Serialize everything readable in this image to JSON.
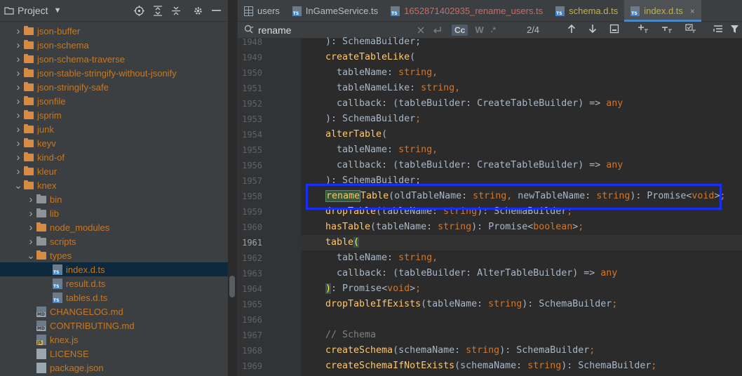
{
  "project": {
    "title": "Project",
    "tree": [
      {
        "label": "json-buffer",
        "kind": "folder",
        "depth": 1,
        "color": "orange",
        "expanded": false
      },
      {
        "label": "json-schema",
        "kind": "folder",
        "depth": 1,
        "color": "orange",
        "expanded": false
      },
      {
        "label": "json-schema-traverse",
        "kind": "folder",
        "depth": 1,
        "color": "orange",
        "expanded": false
      },
      {
        "label": "json-stable-stringify-without-jsonify",
        "kind": "folder",
        "depth": 1,
        "color": "orange",
        "expanded": false
      },
      {
        "label": "json-stringify-safe",
        "kind": "folder",
        "depth": 1,
        "color": "orange",
        "expanded": false
      },
      {
        "label": "jsonfile",
        "kind": "folder",
        "depth": 1,
        "color": "orange",
        "expanded": false
      },
      {
        "label": "jsprim",
        "kind": "folder",
        "depth": 1,
        "color": "orange",
        "expanded": false
      },
      {
        "label": "junk",
        "kind": "folder",
        "depth": 1,
        "color": "orange",
        "expanded": false
      },
      {
        "label": "keyv",
        "kind": "folder",
        "depth": 1,
        "color": "orange",
        "expanded": false
      },
      {
        "label": "kind-of",
        "kind": "folder",
        "depth": 1,
        "color": "orange",
        "expanded": false
      },
      {
        "label": "kleur",
        "kind": "folder",
        "depth": 1,
        "color": "orange",
        "expanded": false
      },
      {
        "label": "knex",
        "kind": "folder",
        "depth": 1,
        "color": "orange",
        "expanded": true
      },
      {
        "label": "bin",
        "kind": "folder",
        "depth": 2,
        "color": "orange",
        "expanded": false
      },
      {
        "label": "lib",
        "kind": "folder",
        "depth": 2,
        "color": "orange",
        "expanded": false
      },
      {
        "label": "node_modules",
        "kind": "folder",
        "depth": 2,
        "color": "orange",
        "expanded": false
      },
      {
        "label": "scripts",
        "kind": "folder",
        "depth": 2,
        "color": "orange",
        "expanded": false
      },
      {
        "label": "types",
        "kind": "folder",
        "depth": 2,
        "color": "orange",
        "expanded": true
      },
      {
        "label": "index.d.ts",
        "kind": "file-ts",
        "depth": 3,
        "color": "orange",
        "selected": true
      },
      {
        "label": "result.d.ts",
        "kind": "file-ts",
        "depth": 3,
        "color": "orange"
      },
      {
        "label": "tables.d.ts",
        "kind": "file-ts",
        "depth": 3,
        "color": "orange"
      },
      {
        "label": "CHANGELOG.md",
        "kind": "file-md",
        "depth": 2,
        "color": "orange"
      },
      {
        "label": "CONTRIBUTING.md",
        "kind": "file-md",
        "depth": 2,
        "color": "orange"
      },
      {
        "label": "knex.js",
        "kind": "file-js",
        "depth": 2,
        "color": "orange"
      },
      {
        "label": "LICENSE",
        "kind": "file-txt",
        "depth": 2,
        "color": "orange"
      },
      {
        "label": "package.json",
        "kind": "file-json",
        "depth": 2,
        "color": "orange"
      }
    ]
  },
  "tabs": [
    {
      "label": "users",
      "icon": "table-icon",
      "color": "normal"
    },
    {
      "label": "InGameService.ts",
      "icon": "ts-file-icon",
      "color": "normal"
    },
    {
      "label": "1652871402935_rename_users.ts",
      "icon": "ts-file-icon",
      "color": "red"
    },
    {
      "label": "schema.d.ts",
      "icon": "ts-file-icon",
      "color": "yellow"
    },
    {
      "label": "index.d.ts",
      "icon": "ts-file-icon",
      "color": "yellow",
      "active": true
    }
  ],
  "search": {
    "query": "rename",
    "match_case_label": "Cc",
    "words_label": "W",
    "regex_label": ".*",
    "match_count": "2/4"
  },
  "editor": {
    "lines": [
      {
        "n": "1948",
        "tokens": [
          [
            "typ",
            "): SchemaBuilder;"
          ]
        ]
      },
      {
        "n": "1949",
        "tokens": [
          [
            "fn",
            "createTableLike"
          ],
          [
            "txt",
            "("
          ]
        ]
      },
      {
        "n": "1950",
        "tokens": [
          [
            "txt",
            "  tableName: "
          ],
          [
            "kw",
            "string,"
          ]
        ]
      },
      {
        "n": "1951",
        "tokens": [
          [
            "txt",
            "  tableNameLike: "
          ],
          [
            "kw",
            "string,"
          ]
        ]
      },
      {
        "n": "1952",
        "tokens": [
          [
            "txt",
            "  callback: (tableBuilder: CreateTableBuilder) => "
          ],
          [
            "kw",
            "any"
          ]
        ]
      },
      {
        "n": "1953",
        "tokens": [
          [
            "txt",
            "): SchemaBuilder"
          ],
          [
            "kw",
            ";"
          ]
        ]
      },
      {
        "n": "1954",
        "tokens": [
          [
            "fn",
            "alterTable"
          ],
          [
            "txt",
            "("
          ]
        ]
      },
      {
        "n": "1955",
        "tokens": [
          [
            "txt",
            "  tableName: "
          ],
          [
            "kw",
            "string,"
          ]
        ]
      },
      {
        "n": "1956",
        "tokens": [
          [
            "txt",
            "  callback: (tableBuilder: CreateTableBuilder) => "
          ],
          [
            "kw",
            "any"
          ]
        ]
      },
      {
        "n": "1957",
        "tokens": [
          [
            "txt",
            "): SchemaBuilder;"
          ]
        ]
      },
      {
        "n": "1958",
        "tokens": [
          [
            "hl",
            "rename"
          ],
          [
            "fn",
            "Table"
          ],
          [
            "txt",
            "(oldTableName: "
          ],
          [
            "kw",
            "string, "
          ],
          [
            "txt",
            "newTableName: "
          ],
          [
            "kw",
            "string"
          ],
          [
            "txt",
            "): Promise<"
          ],
          [
            "kw",
            "void"
          ],
          [
            "txt",
            ">"
          ],
          [
            "kw",
            ";"
          ]
        ]
      },
      {
        "n": "1959",
        "tokens": [
          [
            "fn",
            "dropTable"
          ],
          [
            "txt",
            "(tableName: "
          ],
          [
            "kw",
            "string"
          ],
          [
            "txt",
            "): SchemaBuilder"
          ],
          [
            "kw",
            ";"
          ]
        ]
      },
      {
        "n": "1960",
        "tokens": [
          [
            "fn",
            "hasTable"
          ],
          [
            "txt",
            "(tableName: "
          ],
          [
            "kw",
            "string"
          ],
          [
            "txt",
            "): Promise<"
          ],
          [
            "kw",
            "boolean"
          ],
          [
            "txt",
            ">"
          ],
          [
            "kw",
            ";"
          ]
        ]
      },
      {
        "n": "1961",
        "tokens": [
          [
            "fn",
            "table"
          ],
          [
            "brace",
            "("
          ]
        ],
        "current": true
      },
      {
        "n": "1962",
        "tokens": [
          [
            "txt",
            "  tableName: "
          ],
          [
            "kw",
            "string,"
          ]
        ]
      },
      {
        "n": "1963",
        "tokens": [
          [
            "txt",
            "  callback: (tableBuilder: AlterTableBuilder) => "
          ],
          [
            "kw",
            "any"
          ]
        ]
      },
      {
        "n": "1964",
        "tokens": [
          [
            "brace",
            ")"
          ],
          [
            "txt",
            ": Promise<"
          ],
          [
            "kw",
            "void"
          ],
          [
            "txt",
            ">"
          ],
          [
            "kw",
            ";"
          ]
        ]
      },
      {
        "n": "1965",
        "tokens": [
          [
            "fn",
            "dropTableIfExists"
          ],
          [
            "txt",
            "(tableName: "
          ],
          [
            "kw",
            "string"
          ],
          [
            "txt",
            "): SchemaBuilder"
          ],
          [
            "kw",
            ";"
          ]
        ]
      },
      {
        "n": "1966",
        "tokens": []
      },
      {
        "n": "1967",
        "tokens": [
          [
            "cmt",
            "// Schema"
          ]
        ]
      },
      {
        "n": "1968",
        "tokens": [
          [
            "fn",
            "createSchema"
          ],
          [
            "txt",
            "(schemaName: "
          ],
          [
            "kw",
            "string"
          ],
          [
            "txt",
            "): SchemaBuilder"
          ],
          [
            "kw",
            ";"
          ]
        ]
      },
      {
        "n": "1969",
        "tokens": [
          [
            "fn",
            "createSchemaIfNotExists"
          ],
          [
            "txt",
            "(schemaName: "
          ],
          [
            "kw",
            "string"
          ],
          [
            "txt",
            "): SchemaBuilder"
          ],
          [
            "kw",
            ";"
          ]
        ]
      }
    ]
  }
}
